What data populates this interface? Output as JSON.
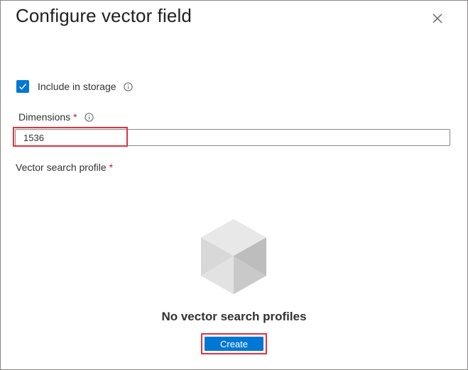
{
  "dialog": {
    "title": "Configure vector field",
    "close_icon": "close-icon"
  },
  "include_storage": {
    "label": "Include in storage",
    "checked": true,
    "info_icon": "info-icon"
  },
  "dimensions": {
    "label": "Dimensions",
    "required_mark": "*",
    "value": "1536",
    "info_icon": "info-icon"
  },
  "vector_search_profile": {
    "label": "Vector search profile",
    "required_mark": "*",
    "empty_icon": "cube-icon",
    "empty_message": "No vector search profiles",
    "create_label": "Create"
  },
  "colors": {
    "accent": "#0078d4",
    "required": "#a4262c",
    "highlight": "#e0323f"
  }
}
